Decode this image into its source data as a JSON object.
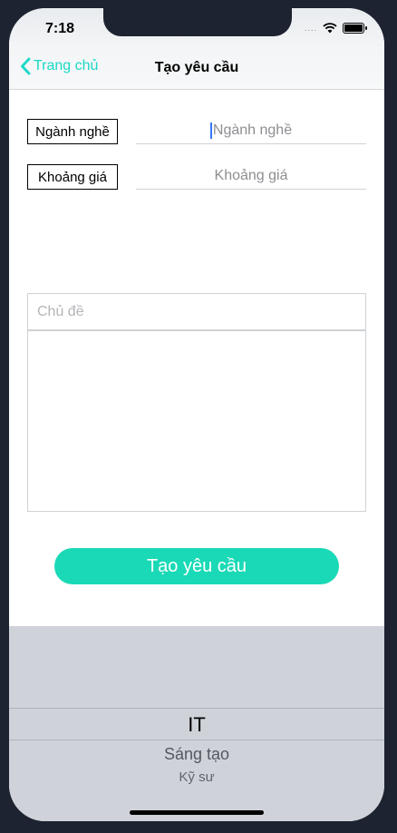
{
  "status_bar": {
    "time": "7:18",
    "signal": "....",
    "wifi_icon": "wifi-icon",
    "battery_icon": "battery-icon"
  },
  "nav": {
    "back_label": "Trang chủ",
    "back_icon": "chevron-left-icon",
    "title": "Tạo yêu cầu",
    "accent_color": "#1ad9c6"
  },
  "form": {
    "industry": {
      "label": "Ngành nghề",
      "placeholder": "Ngành nghề"
    },
    "price_range": {
      "label": "Khoảng giá",
      "placeholder": "Khoảng giá"
    },
    "subject": {
      "placeholder": "Chủ đề",
      "value": ""
    },
    "content": {
      "value": ""
    },
    "submit_label": "Tạo yêu cầu",
    "submit_color": "#1ad9b6"
  },
  "picker": {
    "selected": "IT",
    "options_after": [
      "Sáng tạo",
      "Kỹ sư"
    ]
  }
}
